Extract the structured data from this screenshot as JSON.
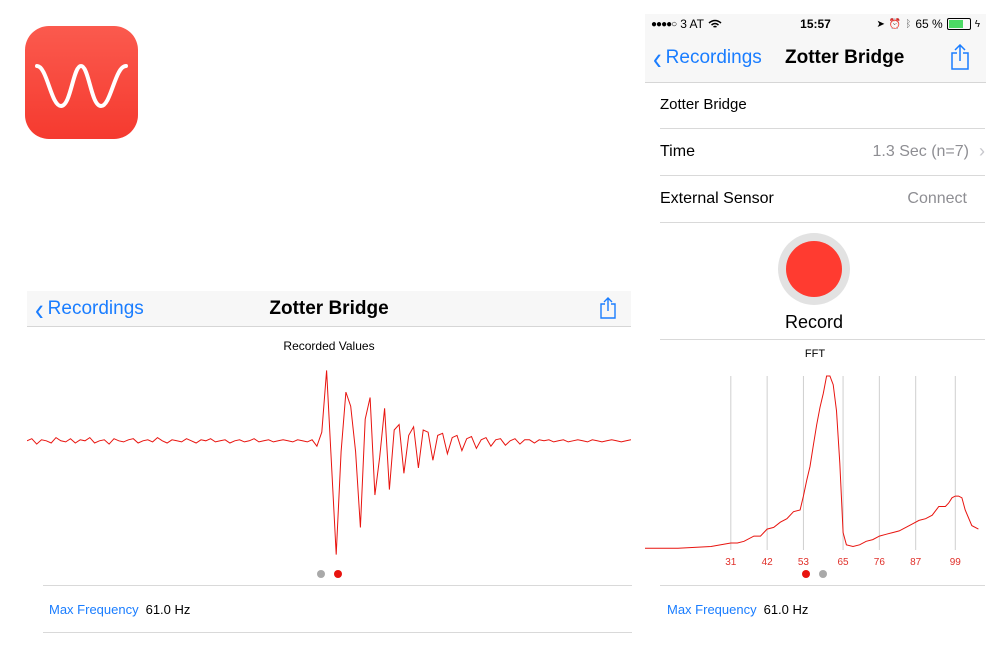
{
  "app_icon": {
    "name": "waveform-icon",
    "color": "#f5453a"
  },
  "left_screen": {
    "nav": {
      "back_label": "Recordings",
      "title": "Zotter Bridge"
    },
    "chart_title": "Recorded Values",
    "page_indicator": {
      "pages": 2,
      "active": 1
    },
    "max_frequency": {
      "label": "Max Frequency",
      "value": "61.0 Hz"
    }
  },
  "right_screen": {
    "status_bar": {
      "carrier": "3 AT",
      "time": "15:57",
      "battery": "65 %"
    },
    "nav": {
      "back_label": "Recordings",
      "title": "Zotter Bridge"
    },
    "recording_name": "Zotter Bridge",
    "rows": [
      {
        "label": "Time",
        "value": "1.3 Sec (n=7)"
      },
      {
        "label": "External Sensor",
        "value": "Connect"
      }
    ],
    "record_label": "Record",
    "fft_title": "FFT",
    "page_indicator": {
      "pages": 2,
      "active": 0
    },
    "max_frequency": {
      "label": "Max Frequency",
      "value": "61.0 Hz"
    }
  },
  "chart_data": [
    {
      "type": "line",
      "title": "Recorded Values",
      "series": [
        {
          "values": [
            0,
            0.2,
            -0.3,
            0.1,
            0,
            -0.2,
            0.3,
            0,
            -0.1,
            0.2,
            -0.2,
            0.1,
            0,
            0.3,
            -0.2,
            0,
            0.1,
            -0.3,
            0.2,
            0,
            -0.1,
            0.1,
            0.2,
            -0.2,
            0,
            0.1,
            -0.1,
            0.3,
            0,
            -0.2,
            0.1,
            0,
            -0.1,
            0.2,
            0,
            -0.2,
            0.1,
            0,
            0.2,
            -0.1,
            0,
            0.1,
            -0.2,
            0,
            0.1,
            -0.1,
            0,
            0.2,
            -0.1,
            0,
            0.1,
            -0.1,
            0,
            0.1,
            0,
            -0.1,
            0.1,
            0,
            -0.1,
            0.1,
            -0.5,
            0.8,
            6.5,
            -2,
            -10.5,
            -1,
            4.5,
            3.2,
            -1,
            -8,
            2,
            4,
            -5,
            -1.5,
            3,
            -4.5,
            1,
            1.5,
            -3,
            0.5,
            1.3,
            -2.5,
            1,
            0.8,
            -1.8,
            0.5,
            0.7,
            -1.2,
            0.3,
            0.5,
            -0.9,
            0.2,
            0.4,
            -0.7,
            0.1,
            0.3,
            -0.5,
            0.1,
            0.2,
            -0.4,
            0,
            0.2,
            -0.3,
            0.1,
            0.1,
            -0.2,
            0.1,
            0,
            0.1,
            -0.1,
            0,
            0.1,
            -0.1,
            0,
            0.1,
            0,
            -0.1,
            0.1,
            0,
            -0.1,
            0,
            0.1,
            0,
            -0.1,
            0,
            0.1
          ]
        }
      ],
      "ylim": [
        -11,
        7
      ],
      "grid": false
    },
    {
      "type": "line",
      "title": "FFT",
      "x_ticks": [
        31,
        42,
        53,
        65,
        76,
        87,
        99
      ],
      "xlim": [
        5,
        108
      ],
      "ylim": [
        0,
        100
      ],
      "grid": true,
      "series": [
        {
          "x": [
            5,
            10,
            15,
            20,
            25,
            28,
            31,
            33,
            35,
            38,
            40,
            42,
            44,
            46,
            48,
            50,
            52,
            53,
            54,
            55,
            56,
            57,
            58,
            59,
            60,
            61,
            62,
            63,
            64,
            65,
            66,
            68,
            70,
            72,
            74,
            76,
            78,
            80,
            82,
            84,
            86,
            88,
            90,
            92,
            94,
            96,
            97,
            98,
            99,
            100,
            101,
            102,
            104,
            106
          ],
          "y": [
            1,
            1,
            1,
            1.5,
            2,
            3,
            4,
            4,
            5,
            8,
            8,
            12,
            13,
            16,
            18,
            22,
            23,
            31,
            40,
            48,
            60,
            72,
            82,
            90,
            100,
            100,
            95,
            80,
            50,
            10,
            3,
            2,
            3,
            5,
            6,
            8,
            9,
            10,
            11,
            13,
            15,
            17,
            18,
            20,
            25,
            25,
            27,
            30,
            31,
            31,
            30,
            23,
            14,
            12
          ]
        }
      ]
    }
  ]
}
